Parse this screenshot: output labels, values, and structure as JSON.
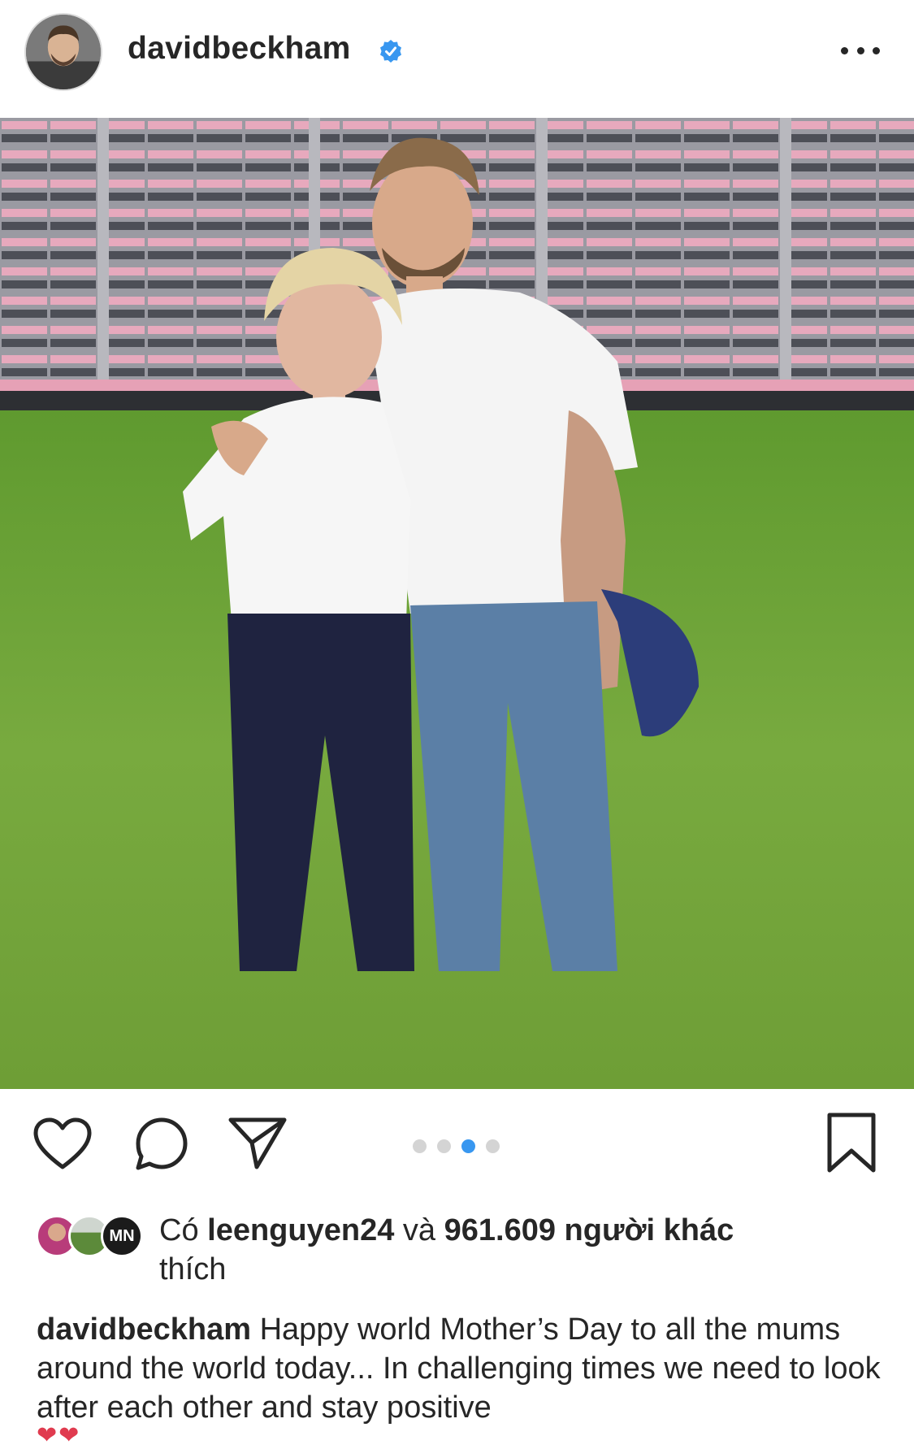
{
  "post": {
    "username": "davidbeckham",
    "verified_icon": "verified-badge-icon",
    "more_icon": "more-options-icon"
  },
  "actions": {
    "like_icon": "heart-icon",
    "comment_icon": "comment-icon",
    "share_icon": "send-icon",
    "save_icon": "bookmark-icon",
    "carousel": {
      "count": 4,
      "active_index": 2
    }
  },
  "likes": {
    "prefix": "Có",
    "user": "leenguyen24",
    "conjunction": "và",
    "count_text": "961.609 người khác",
    "suffix": "thích"
  },
  "caption": {
    "username": "davidbeckham",
    "text": "Happy world Mother’s Day to all the mums around the world today... In challenging times we need to look after each other and stay positive"
  },
  "colors": {
    "accent": "#3897f0",
    "text": "#262626",
    "dot_inactive": "#d4d4d4"
  }
}
